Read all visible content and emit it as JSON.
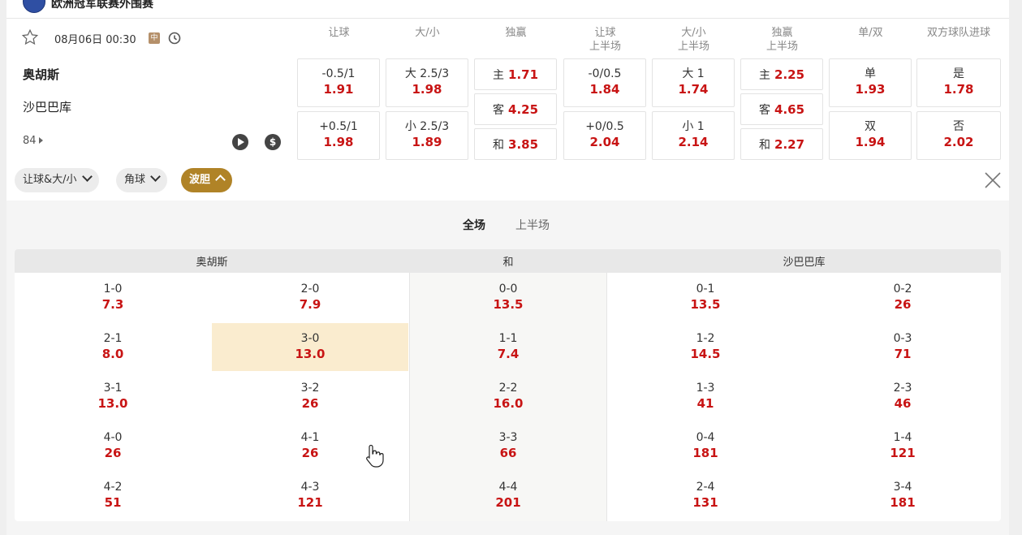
{
  "league": {
    "name": "欧洲冠军联赛外围赛"
  },
  "match": {
    "time": "08月06日 00:30",
    "live_badge": "中",
    "home": "奥胡斯",
    "away": "沙巴巴库",
    "more_count": "84",
    "money_symbol": "$"
  },
  "columns": [
    {
      "line1": "让球",
      "line2": ""
    },
    {
      "line1": "大/小",
      "line2": ""
    },
    {
      "line1": "独赢",
      "line2": ""
    },
    {
      "line1": "让球",
      "line2": "上半场"
    },
    {
      "line1": "大/小",
      "line2": "上半场"
    },
    {
      "line1": "独赢",
      "line2": "上半场"
    },
    {
      "line1": "单/双",
      "line2": ""
    },
    {
      "line1": "双方球队进球",
      "line2": ""
    }
  ],
  "odds": {
    "hcp_ft": [
      {
        "label": "-0.5/1",
        "value": "1.91"
      },
      {
        "label": "+0.5/1",
        "value": "1.98"
      }
    ],
    "ou_ft": [
      {
        "label": "大 2.5/3",
        "value": "1.98"
      },
      {
        "label": "小 2.5/3",
        "value": "1.89"
      }
    ],
    "x12_ft": [
      {
        "label": "主",
        "value": "1.71"
      },
      {
        "label": "客",
        "value": "4.25"
      },
      {
        "label": "和",
        "value": "3.85"
      }
    ],
    "hcp_ht": [
      {
        "label": "-0/0.5",
        "value": "1.84"
      },
      {
        "label": "+0/0.5",
        "value": "2.04"
      }
    ],
    "ou_ht": [
      {
        "label": "大 1",
        "value": "1.74"
      },
      {
        "label": "小 1",
        "value": "2.14"
      }
    ],
    "x12_ht": [
      {
        "label": "主",
        "value": "2.25"
      },
      {
        "label": "客",
        "value": "4.65"
      },
      {
        "label": "和",
        "value": "2.27"
      }
    ],
    "oe": [
      {
        "label": "单",
        "value": "1.93"
      },
      {
        "label": "双",
        "value": "1.94"
      }
    ],
    "btts": [
      {
        "label": "是",
        "value": "1.78"
      },
      {
        "label": "否",
        "value": "2.02"
      }
    ]
  },
  "filters": [
    {
      "label": "让球&大/小"
    },
    {
      "label": "角球"
    },
    {
      "label": "波胆"
    }
  ],
  "correct_score": {
    "tabs": [
      "全场",
      "上半场"
    ],
    "groups": [
      "奥胡斯",
      "和",
      "沙巴巴库"
    ],
    "home_col1": [
      [
        "1-0",
        "7.3"
      ],
      [
        "2-1",
        "8.0"
      ],
      [
        "3-1",
        "13.0"
      ],
      [
        "4-0",
        "26"
      ],
      [
        "4-2",
        "51"
      ]
    ],
    "home_col2": [
      [
        "2-0",
        "7.9"
      ],
      [
        "3-0",
        "13.0"
      ],
      [
        "3-2",
        "26"
      ],
      [
        "4-1",
        "26"
      ],
      [
        "4-3",
        "121"
      ]
    ],
    "draw": [
      [
        "0-0",
        "13.5"
      ],
      [
        "1-1",
        "7.4"
      ],
      [
        "2-2",
        "16.0"
      ],
      [
        "3-3",
        "66"
      ],
      [
        "4-4",
        "201"
      ]
    ],
    "away_col1": [
      [
        "0-1",
        "13.5"
      ],
      [
        "1-2",
        "14.5"
      ],
      [
        "1-3",
        "41"
      ],
      [
        "0-4",
        "181"
      ],
      [
        "2-4",
        "131"
      ]
    ],
    "away_col2": [
      [
        "0-2",
        "26"
      ],
      [
        "0-3",
        "71"
      ],
      [
        "2-3",
        "46"
      ],
      [
        "1-4",
        "121"
      ],
      [
        "3-4",
        "181"
      ]
    ]
  },
  "colors": {
    "accent": "#b08327",
    "odds": "#c81414",
    "highlight": "#faeccf"
  },
  "icons": {
    "favorite": "star-icon",
    "clock": "clock-icon",
    "play": "play-icon",
    "money": "money-icon",
    "close": "close-icon"
  }
}
